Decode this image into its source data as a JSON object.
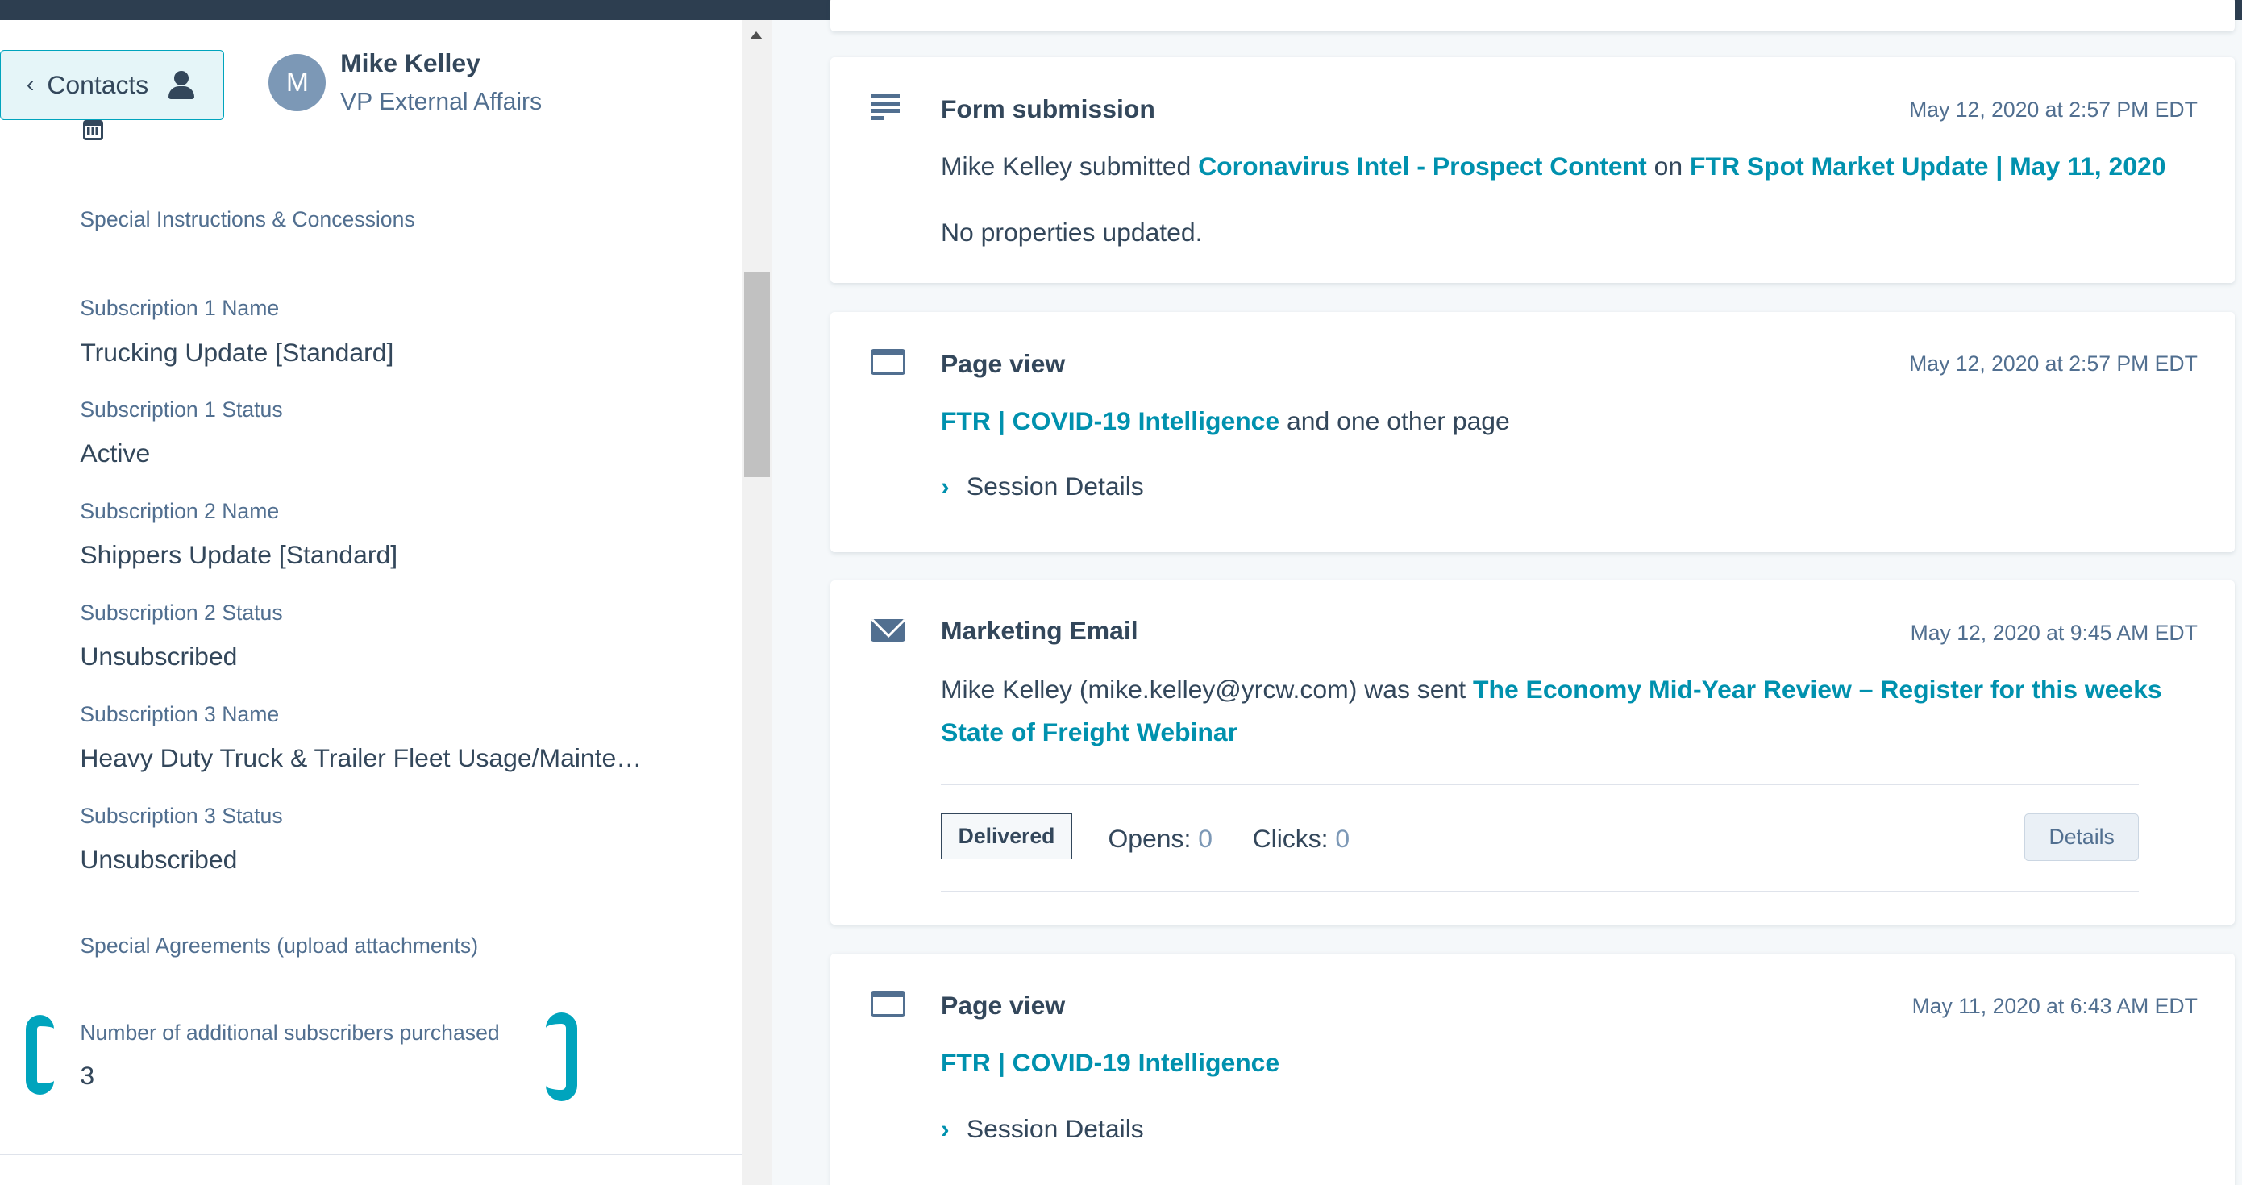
{
  "header": {
    "back_label": "Contacts",
    "avatar_initial": "M",
    "name": "Mike Kelley",
    "title": "VP External Affairs"
  },
  "properties": {
    "special_instructions_label": "Special Instructions & Concessions",
    "sub1_name_label": "Subscription 1 Name",
    "sub1_name_value": "Trucking Update [Standard]",
    "sub1_status_label": "Subscription 1 Status",
    "sub1_status_value": "Active",
    "sub2_name_label": "Subscription 2 Name",
    "sub2_name_value": "Shippers Update [Standard]",
    "sub2_status_label": "Subscription 2 Status",
    "sub2_status_value": "Unsubscribed",
    "sub3_name_label": "Subscription 3 Name",
    "sub3_name_value": "Heavy Duty Truck & Trailer Fleet Usage/Mainte…",
    "sub3_status_label": "Subscription 3 Status",
    "sub3_status_value": "Unsubscribed",
    "special_agreements_label": "Special Agreements (upload attachments)",
    "additional_subs_label": "Number of additional subscribers purchased",
    "additional_subs_value": "3"
  },
  "timeline": {
    "form": {
      "title": "Form submission",
      "time": "May 12, 2020 at 2:57 PM EDT",
      "actor": "Mike Kelley submitted ",
      "form_link": "Coronavirus Intel - Prospect Content",
      "on_word": " on ",
      "page_link": "FTR Spot Market Update | May 11, 2020",
      "note": "No properties updated."
    },
    "pageview1": {
      "title": "Page view",
      "time": "May 12, 2020 at 2:57 PM EDT",
      "link": "FTR | COVID-19 Intelligence",
      "suffix": " and one other page",
      "session": "Session Details"
    },
    "email": {
      "title": "Marketing Email",
      "time": "May 12, 2020 at 9:45 AM EDT",
      "prefix": "Mike Kelley (mike.kelley@yrcw.com) was sent ",
      "link_line1": "The Economy Mid-Year Review – Register for this weeks",
      "link_line2": "State of Freight Webinar",
      "status": "Delivered",
      "opens_label": "Opens:",
      "opens_value": "0",
      "clicks_label": "Clicks:",
      "clicks_value": "0",
      "details_label": "Details"
    },
    "pageview2": {
      "title": "Page view",
      "time": "May 11, 2020 at 6:43 AM EDT",
      "link": "FTR | COVID-19 Intelligence",
      "session": "Session Details"
    }
  },
  "colors": {
    "accent": "#0091ae",
    "highlight_bracket": "#00a4bd",
    "topbar": "#2d3e50"
  }
}
